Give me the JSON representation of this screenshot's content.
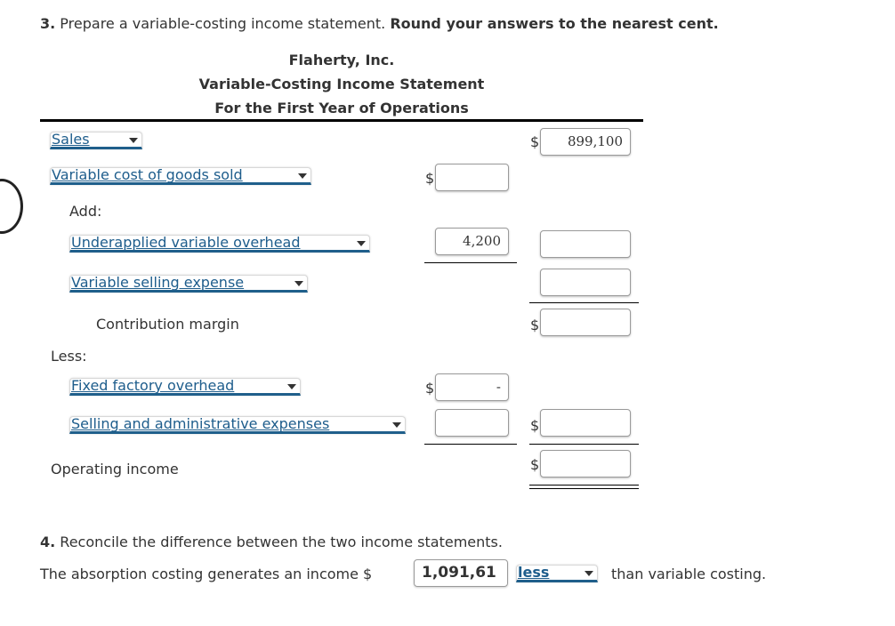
{
  "question3": {
    "number": "3.",
    "text": " Prepare a variable-costing income statement. ",
    "emphasis": "Round your answers to the nearest cent."
  },
  "statement": {
    "company": "Flaherty, Inc.",
    "title": "Variable-Costing Income Statement",
    "period": "For the First Year of Operations",
    "rows": {
      "sales": {
        "selected": "Sales",
        "currency": "$",
        "col2_value": "899,100"
      },
      "variable_cogs": {
        "selected": "Variable cost of goods sold",
        "currency": "$",
        "col1_value": ""
      },
      "add_label": "Add:",
      "underapplied": {
        "selected": "Underapplied variable overhead",
        "col1_value": "4,200",
        "col2_value": ""
      },
      "variable_selling": {
        "selected": "Variable selling expense",
        "col2_value": ""
      },
      "contribution_margin": {
        "label": "Contribution margin",
        "currency": "$",
        "col2_value": ""
      },
      "less_label": "Less:",
      "fixed_overhead": {
        "selected": "Fixed factory overhead",
        "currency": "$",
        "col1_value": "-"
      },
      "selling_admin": {
        "selected": "Selling and administrative expenses",
        "col1_value": "",
        "currency": "$",
        "col2_value": ""
      },
      "operating_income": {
        "label": "Operating income",
        "currency": "$",
        "col2_value": ""
      }
    }
  },
  "question4": {
    "number": "4.",
    "text": " Reconcile the difference between the two income statements.",
    "sentence_prefix": "The absorption costing generates an income $",
    "amount": "1,091,61",
    "comparison_selected": "less",
    "sentence_suffix": "than variable costing."
  },
  "colors": {
    "dropdown_text": "#1e5d8c",
    "dropdown_underline": "#1f5f8b",
    "body_text": "#333333"
  }
}
